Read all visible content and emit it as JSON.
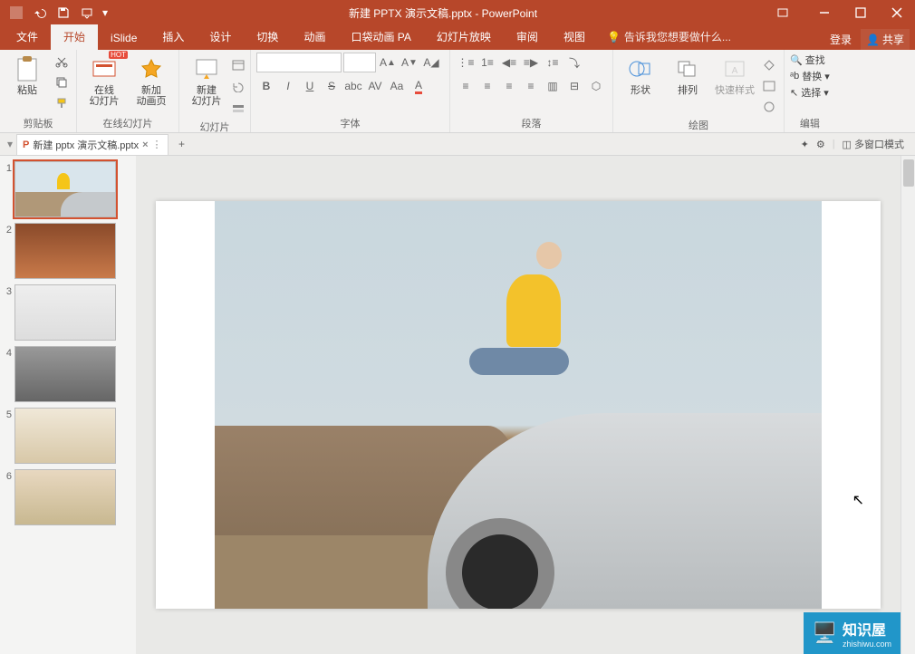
{
  "app": {
    "title": "新建 PPTX 演示文稿.pptx - PowerPoint"
  },
  "titlebar": {
    "login": "登录",
    "share": "共享"
  },
  "tabs": {
    "file": "文件",
    "home": "开始",
    "islide": "iSlide",
    "insert": "插入",
    "design": "设计",
    "transitions": "切换",
    "animations": "动画",
    "pocket": "口袋动画 PA",
    "slideshow": "幻灯片放映",
    "review": "审阅",
    "view": "视图",
    "tellme": "告诉我您想要做什么..."
  },
  "ribbon": {
    "clipboard": {
      "label": "剪贴板",
      "paste": "粘贴"
    },
    "onlineslides": {
      "label": "在线幻灯片",
      "online": "在线\n幻灯片",
      "anim": "新加\n动画页"
    },
    "slides": {
      "label": "幻灯片",
      "new": "新建\n幻灯片"
    },
    "font": {
      "label": "字体"
    },
    "paragraph": {
      "label": "段落"
    },
    "drawing": {
      "label": "绘图",
      "shapes": "形状",
      "arrange": "排列",
      "quickstyle": "快速样式"
    },
    "editing": {
      "label": "编辑",
      "find": "查找",
      "replace": "替换",
      "select": "选择"
    }
  },
  "doctab": {
    "name": "新建 pptx 演示文稿.pptx",
    "multiwindow": "多窗口模式"
  },
  "slides": {
    "count": 6
  },
  "watermark": {
    "name": "知识屋",
    "url": "zhishiwu.com"
  }
}
